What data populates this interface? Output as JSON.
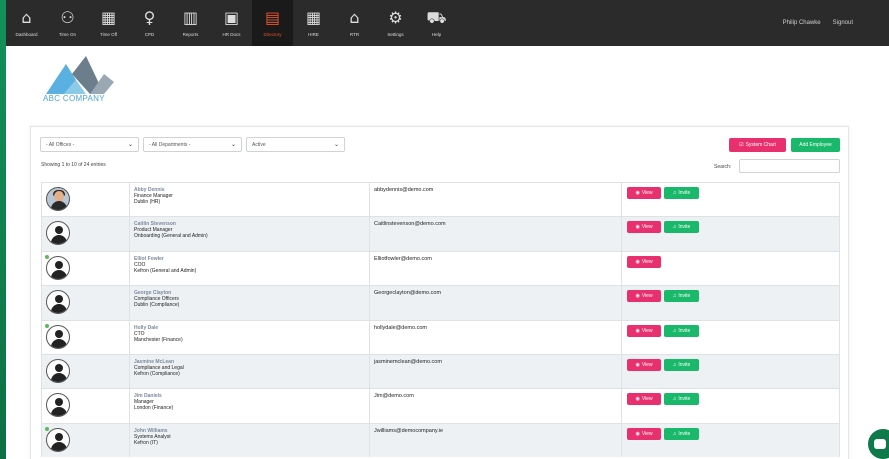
{
  "nav": {
    "items": [
      {
        "label": "Dashboard",
        "icon": "home-icon",
        "glyph": "⌂"
      },
      {
        "label": "Time On",
        "icon": "time-on-icon",
        "glyph": "⚇"
      },
      {
        "label": "Time Off",
        "icon": "time-off-icon",
        "glyph": "▦"
      },
      {
        "label": "CPD",
        "icon": "cpd-icon",
        "glyph": "♀"
      },
      {
        "label": "Reports",
        "icon": "reports-icon",
        "glyph": "▥"
      },
      {
        "label": "HR Docs",
        "icon": "hr-docs-icon",
        "glyph": "▣"
      },
      {
        "label": "Directory",
        "icon": "directory-icon",
        "glyph": "▤"
      },
      {
        "label": "HIRE",
        "icon": "hire-icon",
        "glyph": "▦"
      },
      {
        "label": "RTR",
        "icon": "rtr-icon",
        "glyph": "⌂"
      },
      {
        "label": "Settings",
        "icon": "settings-icon",
        "glyph": "⚙"
      },
      {
        "label": "Help",
        "icon": "help-icon",
        "glyph": "⛟"
      }
    ],
    "active": "Directory",
    "user": "Philip Chawke",
    "signout": "Signout"
  },
  "logo": {
    "text": "ABC COMPANY"
  },
  "filters": {
    "offices": "- All Offices -",
    "departments": "- All Departments -",
    "status": "Active"
  },
  "buttons": {
    "system_chart": "System Chart",
    "add_employee": "Add Employee",
    "view": "View",
    "invite": "Invite"
  },
  "showing": "Showing 1 to 10 of 24 entries",
  "search_label": "Search:",
  "employees": [
    {
      "name": "Abby Dennis",
      "title": "Finance Manager",
      "location": "Dublin (HR)",
      "email": "abbydennis@demo.com",
      "photo": true,
      "online": false,
      "invite": true
    },
    {
      "name": "Caitlin Stevenson",
      "title": "Product Manager",
      "location": "Onboarding (General and Admin)",
      "email": "Caitlinstevenson@demo.com",
      "photo": false,
      "online": false,
      "invite": true
    },
    {
      "name": "Elliot Fowler",
      "title": "COO",
      "location": "Kefron (General and Admin)",
      "email": "Elliotfowler@demo.com",
      "photo": false,
      "online": true,
      "invite": false
    },
    {
      "name": "George Clayton",
      "title": "Compliance Officers",
      "location": "Dublin (Compliance)",
      "email": "Georgeclayton@demo.com",
      "photo": false,
      "online": false,
      "invite": true
    },
    {
      "name": "Holly Dale",
      "title": "CTO",
      "location": "Manchester (Finance)",
      "email": "hollydale@demo.com",
      "photo": false,
      "online": true,
      "invite": true
    },
    {
      "name": "Jasmine McLean",
      "title": "Compliance and Legal",
      "location": "Kefron (Compliance)",
      "email": "jasminemclean@demo.com",
      "photo": false,
      "online": false,
      "invite": true
    },
    {
      "name": "Jim Daniels",
      "title": "Manager",
      "location": "London (Finance)",
      "email": "Jim@demo.com",
      "photo": false,
      "online": false,
      "invite": true
    },
    {
      "name": "John Williams",
      "title": "Systems Analyst",
      "location": "Kefron (IT)",
      "email": "Jwilliams@democompany.ie",
      "photo": false,
      "online": true,
      "invite": true
    }
  ],
  "colors": {
    "accent_pink": "#e8306f",
    "accent_green": "#19b86a",
    "nav_bg": "#2b2b2b",
    "active_nav": "#e8552d"
  }
}
